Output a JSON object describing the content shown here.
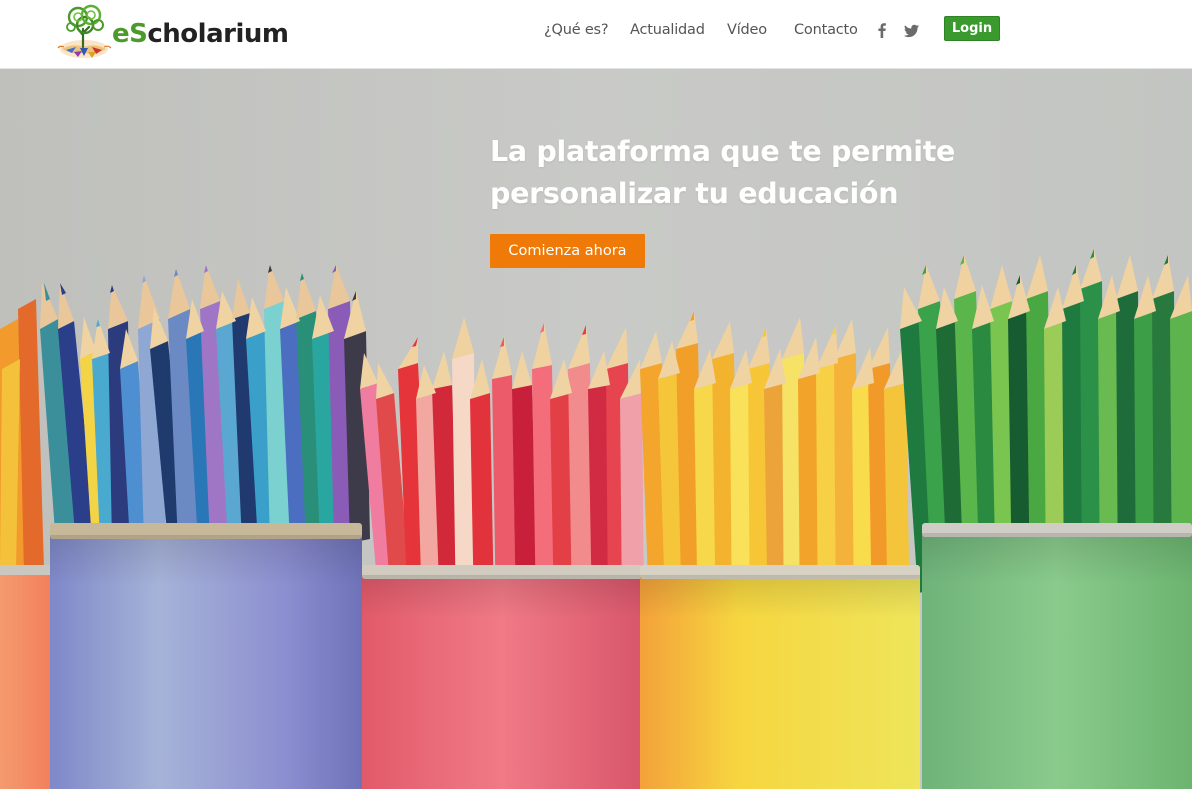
{
  "brand": {
    "name_e": "e",
    "name_s": "S",
    "name_rest": "cholarium",
    "color_green": "#4a9b2c",
    "color_dark": "#222222"
  },
  "nav": {
    "items": [
      {
        "label": "¿Qué es?"
      },
      {
        "label": "Actualidad"
      },
      {
        "label": "Vídeo"
      },
      {
        "label": "Contacto"
      }
    ],
    "social": [
      "facebook-icon",
      "twitter-icon"
    ],
    "login_label": "Login",
    "login_color": "#3a9a2e"
  },
  "hero": {
    "title_line1": "La plataforma que te permite",
    "title_line2": "personalizar tu educación",
    "cta_label": "Comienza ahora",
    "cta_color": "#f07a07",
    "image": "colored-pencils-in-tins"
  }
}
